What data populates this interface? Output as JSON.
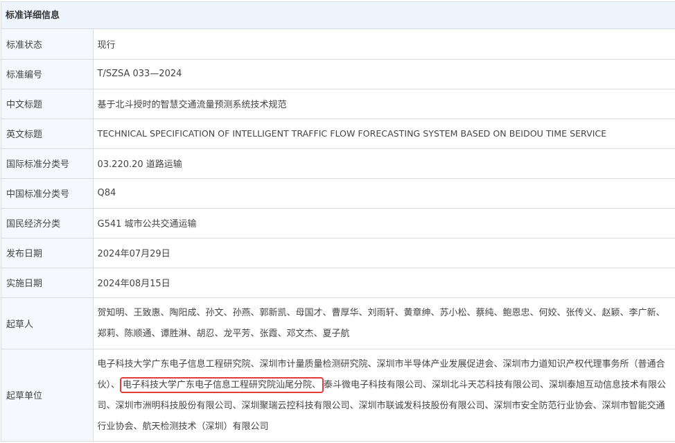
{
  "section_title": "标准详细信息",
  "rows": [
    {
      "label": "标准状态",
      "value": "现行"
    },
    {
      "label": "标准编号",
      "value": "T/SZSA 033—2024"
    },
    {
      "label": "中文标题",
      "value": "基于北斗授时的智慧交通流量预测系统技术规范"
    },
    {
      "label": "英文标题",
      "value": "TECHNICAL SPECIFICATION OF INTELLIGENT TRAFFIC FLOW FORECASTING SYSTEM BASED ON BEIDOU TIME SERVICE"
    },
    {
      "label": "国际标准分类号",
      "value": "03.220.20 道路运输"
    },
    {
      "label": "中国标准分类号",
      "value": "Q84"
    },
    {
      "label": "国民经济分类",
      "value": "G541 城市公共交通运输"
    },
    {
      "label": "发布日期",
      "value": "2024年07月29日"
    },
    {
      "label": "实施日期",
      "value": "2024年08月15日"
    }
  ],
  "drafters": {
    "label": "起草人",
    "value": "贺知明、王致惠、陶阳成、孙文、孙燕、郭新凯、母国才、曹厚华、刘雨轩、黄章绅、苏小松、蔡纯、鲍恩忠、何姣、张传义、赵颖、李广新、郑莉、陈顺通、谭胜淋、胡忍、龙平芳、张霞、邓文杰、夏子航"
  },
  "units": {
    "label": "起草单位",
    "before": "电子科技大学广东电子信息工程研究院、深圳市计量质量检测研究院、深圳市半导体产业发展促进会、深圳市力道知识产权代理事务所（普通合伙）、",
    "highlight": "电子科技大学广东电子信息工程研究院汕尾分院、",
    "after": "泰斗微电子科技有限公司、深圳北斗天芯科技有限公司、深圳泰旭互动信息技术有限公司、深圳市洲明科技股份有限公司、深圳聚瑞云控科技有限公司、深圳市联诚发科技股份有限公司、深圳市安全防范行业协会、深圳市智能交通行业协会、航天检测技术（深圳）有限公司"
  }
}
